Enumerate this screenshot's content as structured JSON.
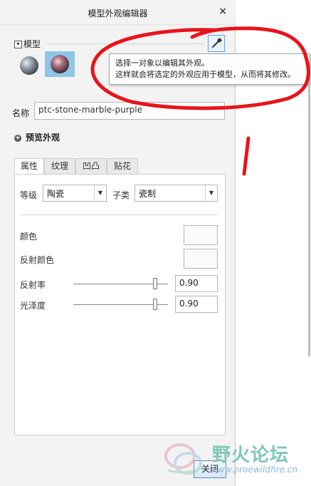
{
  "dialog": {
    "title": "模型外观编辑器",
    "close_icon": "close-icon"
  },
  "model_section": {
    "header": "模型",
    "collapse_icon": "collapse-toggle-icon",
    "eyedropper_icon": "eyedropper-icon",
    "swatches": [
      "steel-sphere-icon",
      "stone-marble-purple-sphere-icon"
    ],
    "tooltip": [
      "选择一对象以编辑其外观。",
      "这样就会将选定的外观应用于模型，从而将其修改。"
    ]
  },
  "name_field": {
    "label": "名称",
    "value": "ptc-stone-marble-purple"
  },
  "preview": {
    "label": "预览外观",
    "icon": "expand-plus-icon"
  },
  "tabs": [
    {
      "label": "属性",
      "active": true
    },
    {
      "label": "纹理",
      "active": false
    },
    {
      "label": "凹凸",
      "active": false
    },
    {
      "label": "贴花",
      "active": false
    }
  ],
  "properties": {
    "class_label": "等级",
    "class_value": "陶瓷",
    "subclass_label": "子类",
    "subclass_value": "瓷制",
    "color_label": "颜色",
    "color_value": "#fafafa",
    "reflection_color_label": "反射颜色",
    "reflection_color_value": "#fafafa",
    "reflectivity_label": "反射率",
    "reflectivity_value": "0.90",
    "gloss_label": "光泽度",
    "gloss_value": "0.90"
  },
  "footer": {
    "close_label": "关闭"
  },
  "watermark": {
    "text": "野火论坛",
    "url": "www.proewildfire.cn"
  },
  "colors": {
    "annotation": "#e8141b",
    "highlight": "#8ec6ea",
    "dialog_bg": "#f3f3f3"
  }
}
